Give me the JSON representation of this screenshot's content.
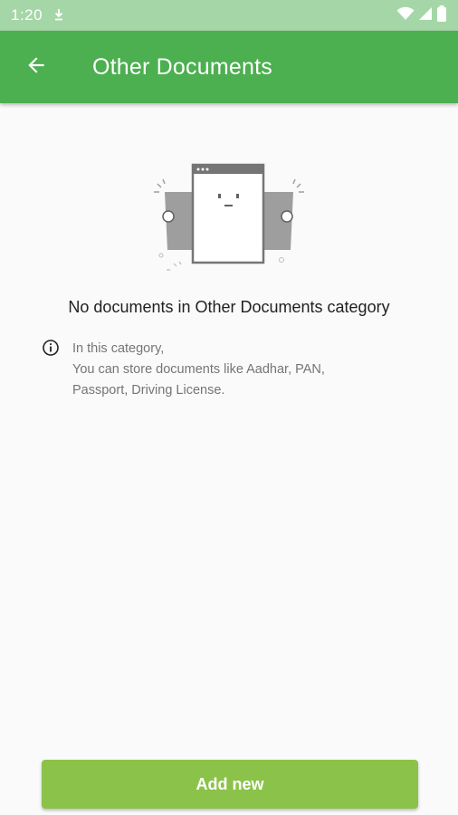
{
  "status_bar": {
    "time": "1:20",
    "icons": [
      "download-icon",
      "wifi-icon",
      "signal-icon",
      "battery-icon"
    ]
  },
  "app_bar": {
    "title": "Other Documents",
    "back_icon": "arrow-back-icon",
    "color": "#4caf50"
  },
  "empty_state": {
    "illustration": "empty-documents-illustration",
    "title": "No documents in Other Documents category",
    "info_icon": "info-icon",
    "info_lines": [
      "In this category,",
      "You can store documents like Aadhar, PAN,",
      "Passport, Driving License."
    ]
  },
  "footer": {
    "add_label": "Add new",
    "button_color": "#8bc34a"
  }
}
